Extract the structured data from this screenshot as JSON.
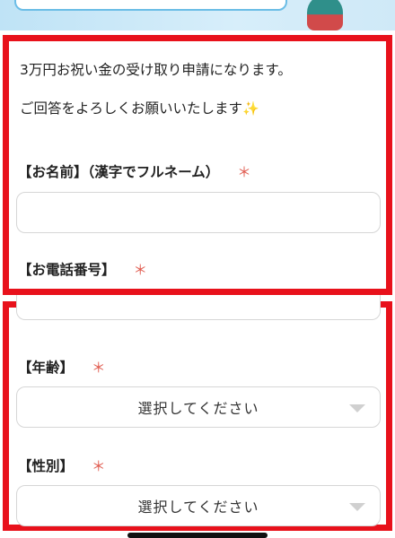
{
  "colors": {
    "accent_border": "#e8111b",
    "required_mark": "#e05a4e"
  },
  "intro": {
    "line1": "3万円お祝い金の受け取り申請になります。",
    "line2": "ご回答をよろしくお願いいたします",
    "line2_emoji": "✨"
  },
  "fields": {
    "name_label": "【お名前】（漢字でフルネーム）",
    "phone_label": "【お電話番号】",
    "age_label": "【年齢】",
    "gender_label": "【性別】",
    "required_mark": "＊",
    "name_value": ""
  },
  "selects": {
    "age_value": "選択してください",
    "gender_value": "選択してください"
  },
  "icons": {
    "dropdown": "chevron-down-icon",
    "sparkle": "sparkles-icon"
  }
}
